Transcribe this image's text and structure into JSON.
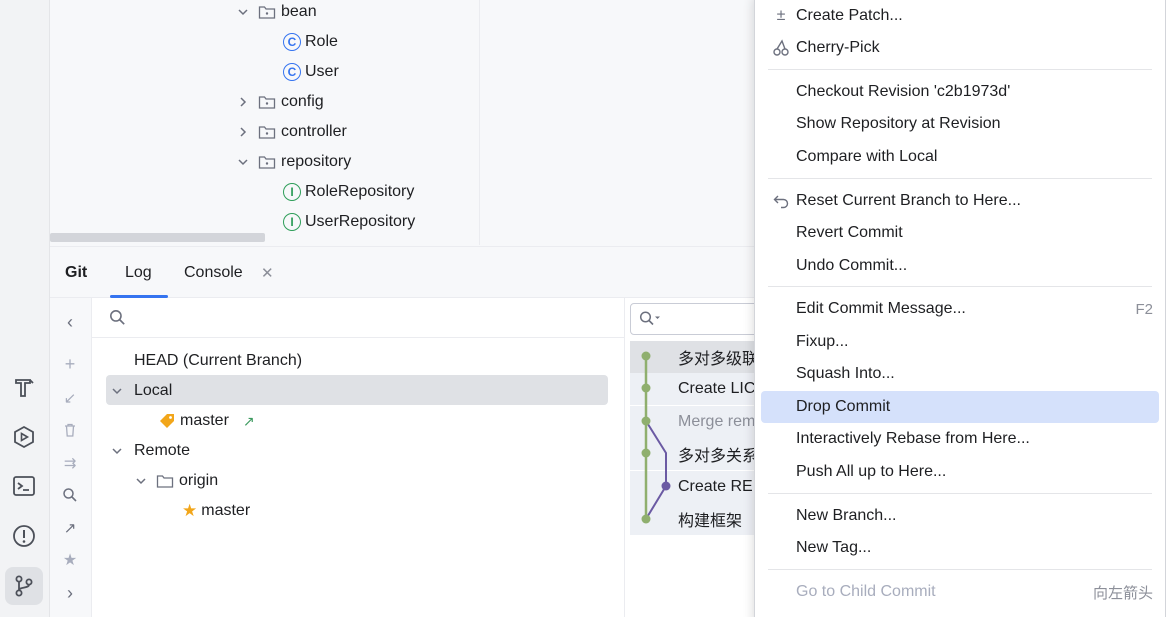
{
  "activity_bar": {
    "icons": [
      "build-icon",
      "run-icon",
      "terminal-icon",
      "problems-icon",
      "git-icon"
    ]
  },
  "project_tree": {
    "items": [
      {
        "label": "bean",
        "type": "folder",
        "expanded": true
      },
      {
        "label": "Role",
        "type": "class"
      },
      {
        "label": "User",
        "type": "class"
      },
      {
        "label": "config",
        "type": "folder",
        "expanded": false
      },
      {
        "label": "controller",
        "type": "folder",
        "expanded": false
      },
      {
        "label": "repository",
        "type": "folder",
        "expanded": true
      },
      {
        "label": "RoleRepository",
        "type": "interface"
      },
      {
        "label": "UserRepository",
        "type": "interface"
      }
    ]
  },
  "git_window": {
    "title": "Git",
    "tabs": [
      {
        "label": "Log",
        "active": true
      },
      {
        "label": "Console",
        "closable": true
      }
    ]
  },
  "branches": {
    "head": "HEAD (Current Branch)",
    "local_label": "Local",
    "local_master": "master",
    "remote_label": "Remote",
    "origin_label": "origin",
    "remote_master": "master"
  },
  "log": {
    "commits": [
      {
        "message": "多对多级联"
      },
      {
        "message": "Create LIC"
      },
      {
        "message": "Merge rem"
      },
      {
        "message": "多对多关系"
      },
      {
        "message": "Create RE"
      },
      {
        "message": "构建框架"
      }
    ]
  },
  "context_menu": {
    "items": [
      {
        "label": "Create Patch...",
        "icon": "patch-icon"
      },
      {
        "label": "Cherry-Pick",
        "icon": "cherry-icon"
      },
      {
        "label": "Checkout Revision 'c2b1973d'"
      },
      {
        "label": "Show Repository at Revision"
      },
      {
        "label": "Compare with Local"
      },
      {
        "label": "Reset Current Branch to Here...",
        "icon": "reset-icon"
      },
      {
        "label": "Revert Commit"
      },
      {
        "label": "Undo Commit..."
      },
      {
        "label": "Edit Commit Message...",
        "shortcut": "F2"
      },
      {
        "label": "Fixup..."
      },
      {
        "label": "Squash Into..."
      },
      {
        "label": "Drop Commit",
        "selected": true
      },
      {
        "label": "Interactively Rebase from Here..."
      },
      {
        "label": "Push All up to Here..."
      },
      {
        "label": "New Branch..."
      },
      {
        "label": "New Tag..."
      },
      {
        "label": "Go to Child Commit",
        "disabled": true,
        "shortcut": "向左箭头"
      }
    ]
  },
  "colors": {
    "accent": "#3574f0",
    "menu_selection": "#d5e1fb",
    "graph_green": "#8faf6e",
    "graph_purple": "#6b5aa3"
  }
}
